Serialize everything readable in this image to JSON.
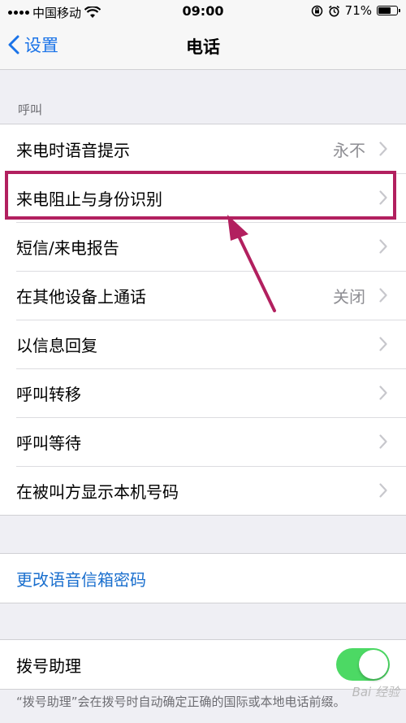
{
  "status_bar": {
    "carrier": "中国移动",
    "time": "09:00",
    "battery_percent": "71%",
    "battery_level": 0.71
  },
  "nav": {
    "back_label": "设置",
    "title": "电话"
  },
  "calls_section": {
    "header": "呼叫",
    "rows": [
      {
        "label": "来电时语音提示",
        "value": "永不"
      },
      {
        "label": "来电阻止与身份识别",
        "value": ""
      },
      {
        "label": "短信/来电报告",
        "value": ""
      },
      {
        "label": "在其他设备上通话",
        "value": "关闭"
      },
      {
        "label": "以信息回复",
        "value": ""
      },
      {
        "label": "呼叫转移",
        "value": ""
      },
      {
        "label": "呼叫等待",
        "value": ""
      },
      {
        "label": "在被叫方显示本机号码",
        "value": ""
      }
    ]
  },
  "voicemail": {
    "change_password": "更改语音信箱密码"
  },
  "dial_assist": {
    "label": "拨号助理",
    "enabled": true,
    "footnote": "“拨号助理”会在拨号时自动确定正确的国际或本地电话前缀。"
  },
  "watermark": "Bai 经验",
  "colors": {
    "accent": "#1a73e8",
    "highlight": "#b2205f",
    "toggle_on": "#4cd964"
  }
}
